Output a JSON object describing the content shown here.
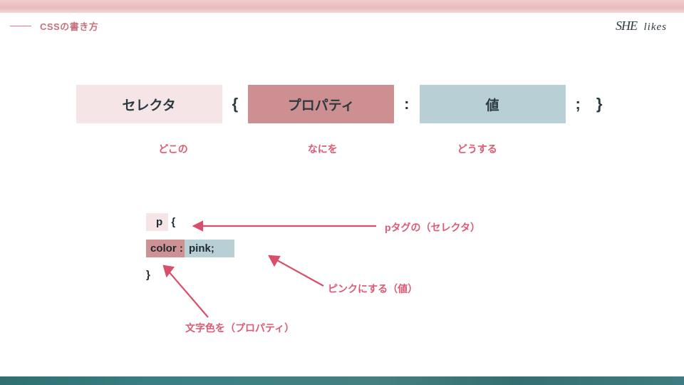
{
  "header": {
    "title": "CSSの書き方",
    "brand_she": "SHE",
    "brand_likes": "likes"
  },
  "syntax": {
    "selector": "セレクタ",
    "brace_open": "{",
    "property": "プロパティ",
    "colon": ":",
    "value": "値",
    "semicolon": ";",
    "brace_close": "}",
    "labels": {
      "selector": "どこの",
      "property": "なにを",
      "value": "どうする"
    }
  },
  "code": {
    "line1_sel": "p",
    "line1_brace": " {",
    "line2_prop": "color :",
    "line2_val": " pink;",
    "line3_close": "}"
  },
  "annotations": {
    "selector": "pタグの（セレクタ）",
    "value": "ピンクにする（値）",
    "property": "文字色を（プロパティ）"
  }
}
